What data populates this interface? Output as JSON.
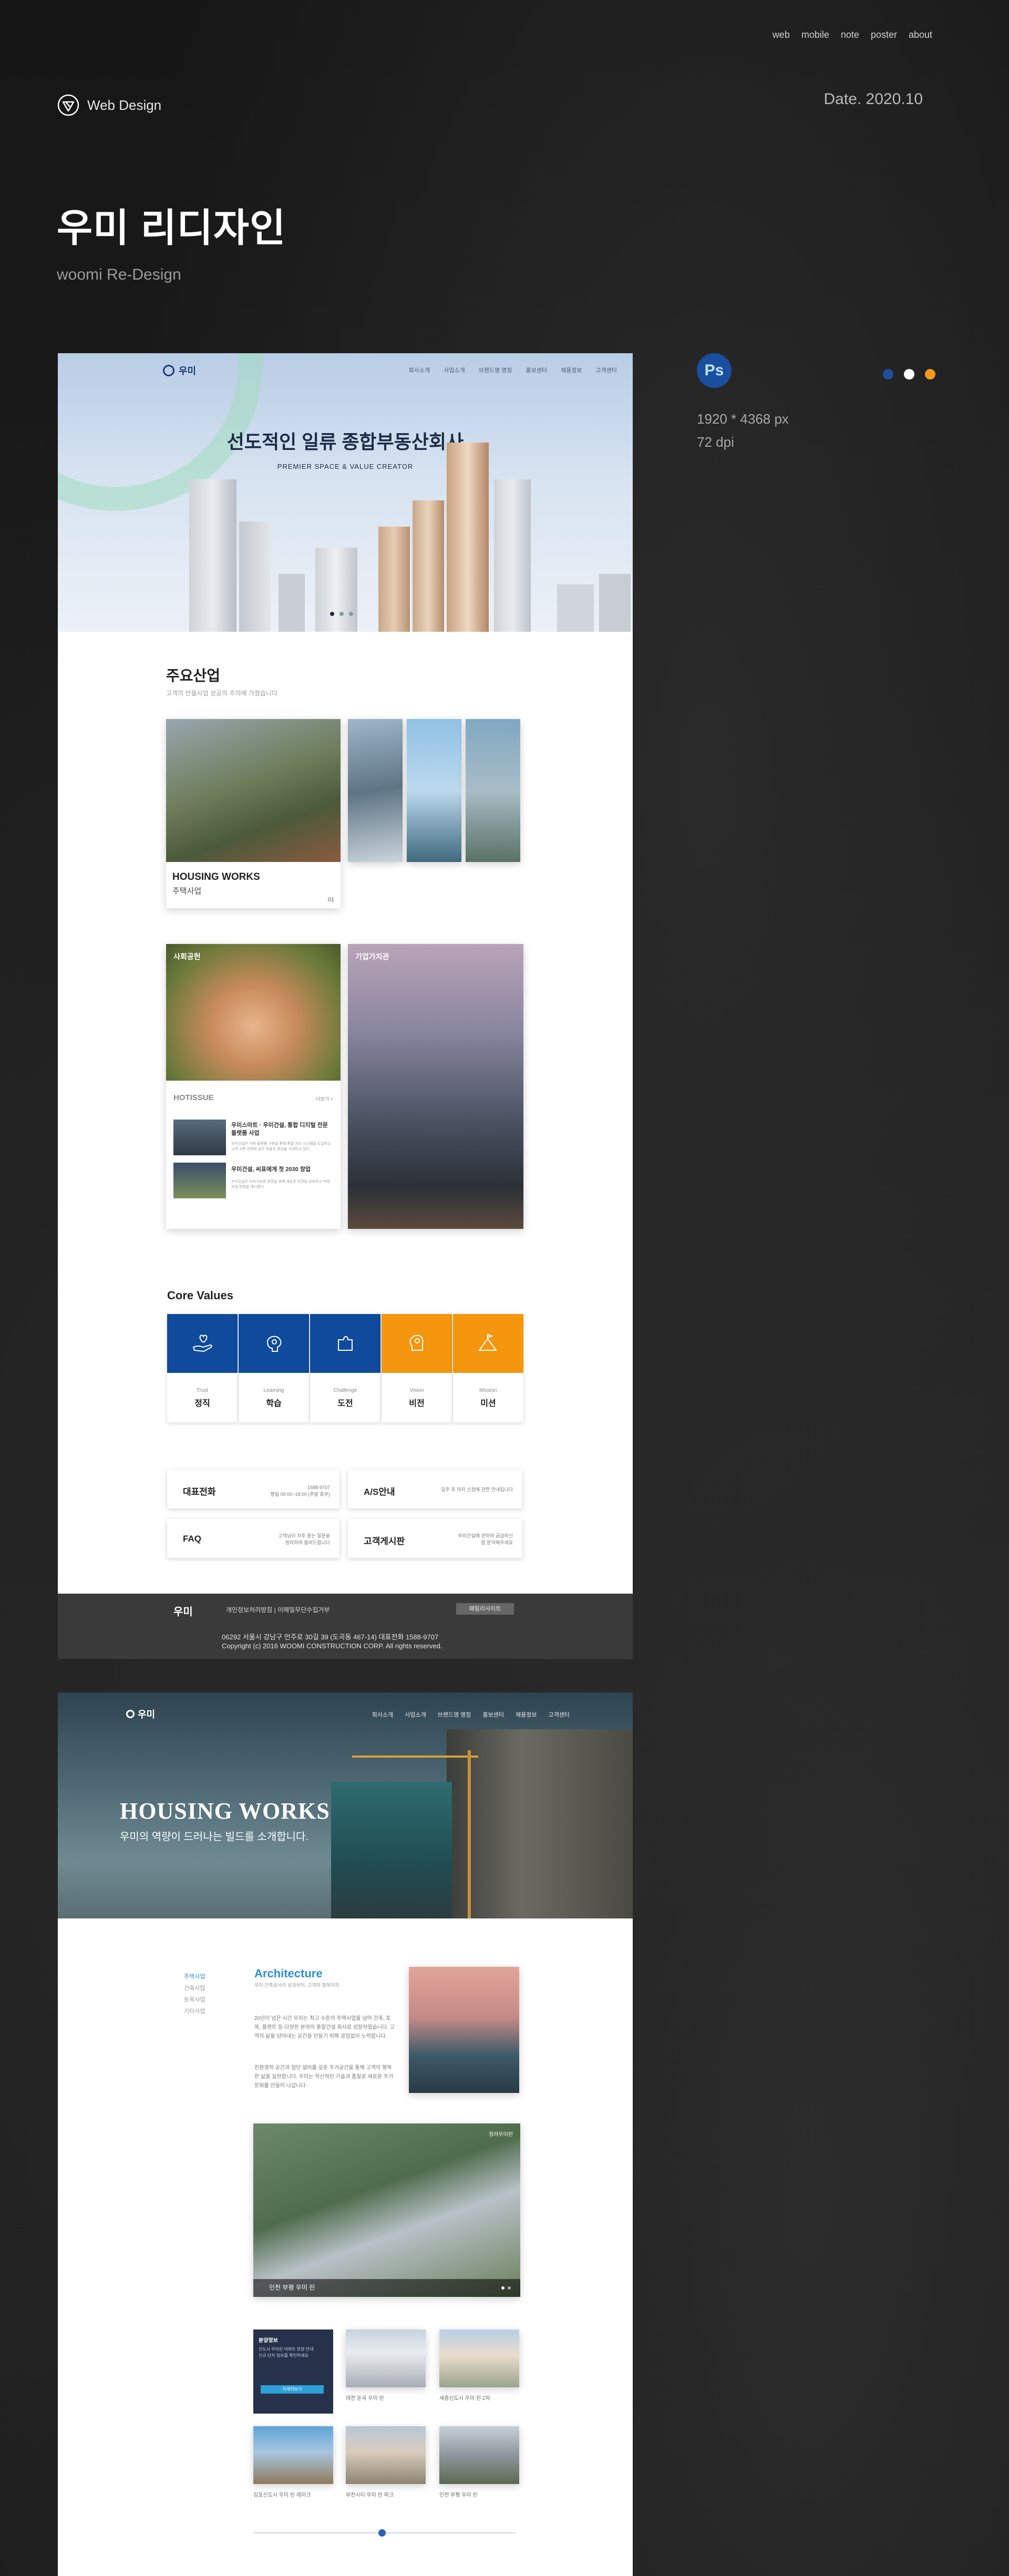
{
  "nav": {
    "items": [
      "web",
      "mobile",
      "note",
      "poster",
      "about"
    ]
  },
  "brand": {
    "label": "Web Design",
    "icon": "ribbon-logo-icon"
  },
  "date": "Date. 2020.10",
  "hero": {
    "title": "우미 리디자인",
    "subtitle": "woomi Re-Design"
  },
  "meta": {
    "tool": "Ps",
    "size": "1920 * 4368 px",
    "dpi": "72 dpi",
    "swatches": [
      "#1d4f9c",
      "#ffffff",
      "#f39a1f"
    ]
  },
  "mock1": {
    "logo": "우미",
    "menu": [
      "회사소개",
      "사업소개",
      "브랜드명 명칭",
      "홍보센터",
      "채용정보",
      "고객센터"
    ],
    "headline": "선도적인 일류 종합부동산회사",
    "tagline": "PREMIER SPACE & VALUE CREATOR",
    "industry": {
      "title": "주요산업",
      "desc": "고객의 만을사업 성공의 주의에 가졌습니다",
      "housing_title": "HOUSING WORKS",
      "housing_sub": "주택사업",
      "housing_num": "01"
    },
    "social": {
      "title": "사회공헌",
      "culture": "기업가치관",
      "hotissue": "HOTISSUE",
      "more": "더보기 +",
      "news": [
        {
          "title": "우미스마트 · 우미건설, 통합 디지털 전문플랫폼 사업",
          "body": "우미건설은 이번 플랫폼 구축을 통해 통합 관리 시스템을 도입하고 고객 소통 강화와 업무 효율성 향상을 기대하고 있다."
        },
        {
          "title": "우미건설, 씨표에게 첫 2030 창업",
          "body": "우미건설은 지속가능한 성장을 위해 새로운 비전을 선포하고 미래 사업 방향을 제시했다."
        }
      ]
    },
    "core": {
      "title": "Core Values",
      "items": [
        {
          "en": "Trust",
          "ko": "정직",
          "color": "#0f4a9c",
          "icon": "hand-heart-icon"
        },
        {
          "en": "Learning",
          "ko": "학습",
          "color": "#0f4a9c",
          "icon": "brain-gear-icon"
        },
        {
          "en": "Challenge",
          "ko": "도전",
          "color": "#0f4a9c",
          "icon": "puzzle-icon"
        },
        {
          "en": "Vision",
          "ko": "비전",
          "color": "#f5960f",
          "icon": "head-bulb-icon"
        },
        {
          "en": "Mission",
          "ko": "미션",
          "color": "#f5960f",
          "icon": "mountain-flag-icon"
        }
      ]
    },
    "contacts": [
      {
        "title": "대표전화",
        "text": "1588-9707\n평일 09:00~18:00 (주말 휴무)"
      },
      {
        "title": "A/S안내",
        "text": "입주 후 하자 신청에 관한 안내입니다"
      },
      {
        "title": "FAQ",
        "text": "고객님이 자주 묻는 질문을\n정리하여 알려드립니다"
      },
      {
        "title": "고객게시판",
        "text": "우미건설에 관하여 궁금하신\n점 문의해주세요"
      }
    ],
    "footer": {
      "logo": "우미",
      "links": "개인정보처리방침 | 이메일무단수집거부",
      "button": "패밀리사이트",
      "address": "06292 서울시 강남구 언주로 30길 39 (도곡동 467-14) 대표전화 1588-9707",
      "copyright": "Copyright (c) 2016 WOOMI CONSTRUCTION CORP. All rights reserved."
    }
  },
  "mock2": {
    "logo": "우미",
    "menu": [
      "회사소개",
      "사업소개",
      "브랜드명 명칭",
      "홍보센터",
      "채용정보",
      "고객센터"
    ],
    "title": "HOUSING WORKS",
    "subtitle": "우미의 역량이 드러나는 빌드를 소개합니다.",
    "side": [
      "주택사업",
      "건축사업",
      "토목사업",
      "기타사업"
    ],
    "arch_title": "Architecture",
    "arch_line": "우미 건축공사의 성과부터, 고객의 행복까지",
    "arch_text": "20년이 넘은 시간 우미는 최고 수준의 주택사업을 넘어 건축, 토목, 플랜트 등 다양한 분야의 종합건설 회사로 성장하였습니다. 고객의 삶을 담아내는 공간을 만들기 위해 끊임없이 노력합니다.",
    "arch_text2": "친환경적 공간과 첨단 설비를 갖춘 주거공간을 통해 고객의 행복한 삶을 실현합니다. 우미는 혁신적인 기술과 품질로 새로운 주거문화를 만들어 나갑니다.",
    "big_caption": "인천 부평 우미 린",
    "big_caption_corner": "청라우미린",
    "highlight": {
      "title": "분양정보",
      "body": "신도시 우미린 아파트 분양 안내\n신규 단지 정보를 확인하세요",
      "button": "자세히보기"
    },
    "thumbs": [
      "대전 둔곡 우미 린",
      "세종신도시 우미 린 2차",
      "김포신도시 우미 린 레이크",
      "부천시티 우미 린 파크",
      "인천 부평 우미 린"
    ]
  }
}
